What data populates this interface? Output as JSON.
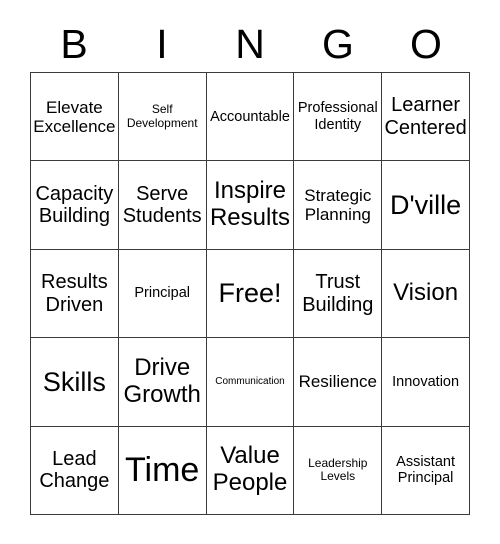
{
  "card": {
    "header_letters": [
      "B",
      "I",
      "N",
      "G",
      "O"
    ],
    "free_space_label": "Free!",
    "rows": [
      [
        {
          "text": "Elevate Excellence",
          "size": "lg"
        },
        {
          "text": "Self Development",
          "size": "sm"
        },
        {
          "text": "Accountable",
          "size": "md"
        },
        {
          "text": "Professional Identity",
          "size": "md"
        },
        {
          "text": "Learner Centered",
          "size": "xl"
        }
      ],
      [
        {
          "text": "Capacity Building",
          "size": "xl"
        },
        {
          "text": "Serve Students",
          "size": "xl"
        },
        {
          "text": "Inspire Results",
          "size": "2xl"
        },
        {
          "text": "Strategic Planning",
          "size": "lg"
        },
        {
          "text": "D'ville",
          "size": "3xl"
        }
      ],
      [
        {
          "text": "Results Driven",
          "size": "xl"
        },
        {
          "text": "Principal",
          "size": "md"
        },
        {
          "text": "Free!",
          "size": "3xl"
        },
        {
          "text": "Trust Building",
          "size": "xl"
        },
        {
          "text": "Vision",
          "size": "2xl"
        }
      ],
      [
        {
          "text": "Skills",
          "size": "3xl"
        },
        {
          "text": "Drive Growth",
          "size": "2xl"
        },
        {
          "text": "Communication",
          "size": "xs"
        },
        {
          "text": "Resilience",
          "size": "lg"
        },
        {
          "text": "Innovation",
          "size": "md"
        }
      ],
      [
        {
          "text": "Lead Change",
          "size": "xl"
        },
        {
          "text": "Time",
          "size": "4xl"
        },
        {
          "text": "Value People",
          "size": "2xl"
        },
        {
          "text": "Leadership Levels",
          "size": "sm"
        },
        {
          "text": "Assistant Principal",
          "size": "md"
        }
      ]
    ]
  },
  "colors": {
    "background": "#ffffff",
    "border": "#3b3b3b",
    "text": "#000000"
  }
}
